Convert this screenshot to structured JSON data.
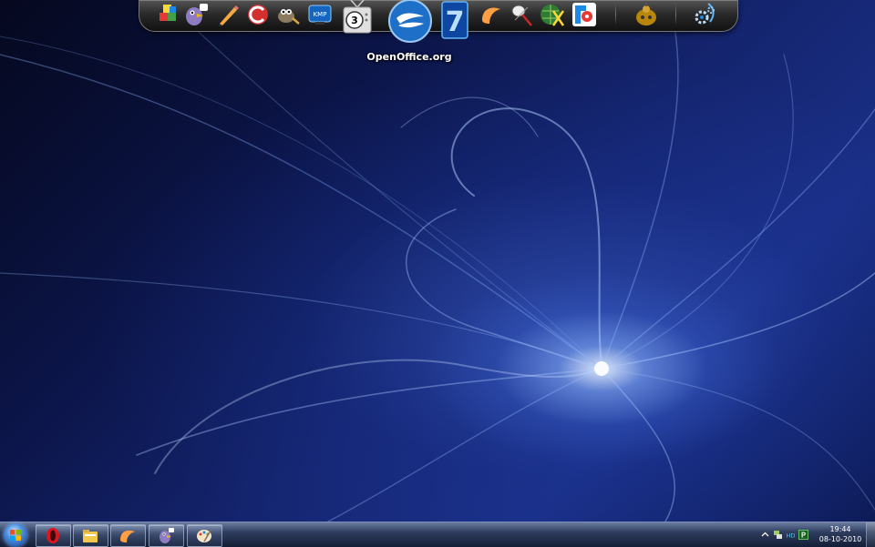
{
  "desktop": {
    "wallpaper": "blue-fractal-flame",
    "accent_colors": [
      "#05081e",
      "#14246e",
      "#8fb4ff",
      "#eaf2ff"
    ]
  },
  "dock": {
    "hover_label": "OpenOffice.org",
    "icons": [
      {
        "name": "cubes-app-icon"
      },
      {
        "name": "pidgin-icon"
      },
      {
        "name": "pencil-icon"
      },
      {
        "name": "ccleaner-icon"
      },
      {
        "name": "gimp-icon"
      },
      {
        "name": "kmplayer-icon"
      },
      {
        "name": "tv-3-icon"
      },
      {
        "name": "openoffice-icon"
      },
      {
        "name": "seven-remix-icon"
      },
      {
        "name": "orange-app-icon"
      },
      {
        "name": "badminton-icon"
      },
      {
        "name": "globe-x-icon"
      },
      {
        "name": "target-app-icon"
      },
      {
        "name": "machinarium-robot-icon"
      },
      {
        "name": "settings-gears-icon"
      }
    ],
    "kmp_text": "KMP",
    "tv_number": "3",
    "seven_text": "7"
  },
  "taskbar": {
    "pinned": [
      {
        "name": "opera-icon"
      },
      {
        "name": "file-explorer-icon"
      },
      {
        "name": "orange-app-icon"
      },
      {
        "name": "pidgin-icon"
      },
      {
        "name": "paint-icon"
      }
    ],
    "tray": {
      "icons": [
        "show-hidden-icons-arrow",
        "network-icon",
        "hd-indicator-icon",
        "green-p-icon"
      ],
      "hd_text": "HD",
      "p_text": "P"
    },
    "clock": {
      "time": "19:44",
      "date": "08-10-2010"
    }
  }
}
